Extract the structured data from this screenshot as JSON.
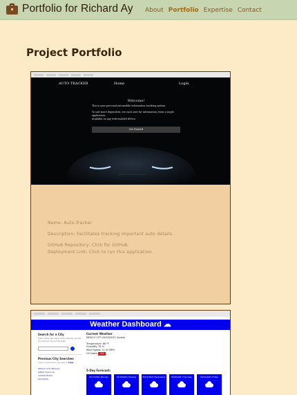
{
  "header": {
    "brand_icon": "briefcase-icon",
    "title": "Portfolio for Richard Ay",
    "nav": [
      {
        "label": "About",
        "active": false
      },
      {
        "label": "Portfolio",
        "active": true
      },
      {
        "label": "Expertise",
        "active": false
      },
      {
        "label": "Contact",
        "active": false
      }
    ]
  },
  "main": {
    "section_title": "Project Portfolio"
  },
  "projects": [
    {
      "screenshot": {
        "nav": {
          "brand": "AUTO TRACKER",
          "home": "Home",
          "login": "Login"
        },
        "welcome_title": "Welcome!",
        "welcome_line1": "This is your personal automobile information tracking system.",
        "welcome_line2": "To sort more dependent, see each user for information, from a single application,",
        "welcome_line3": "available on any web-enabled device.",
        "button": "Get Started"
      },
      "name": "Name: Auto-Tracker",
      "description": "Description: Facilitates tracking important auto details.",
      "github": "GitHub Repository: Click for GitHub.",
      "deployment": "Deployment Link: Click to run this application."
    },
    {
      "screenshot": {
        "title": "Weather Dashboard",
        "search_label": "Search for a City",
        "search_hint": "Enter either the name of the desired city OR the desired city and its state",
        "previous_label": "Previous City Searches",
        "previous_hint": "Click on a previous city search",
        "clear_label": "Clear",
        "cities": [
          "MEXICO CITY,MEXICO",
          "GREAT FALLS,US",
          "AUSTIN,TEXAS",
          "HOUSTON"
        ],
        "current_label": "Current Weather",
        "city_line": "MEXICO CITY 05/05/2021 Sunday",
        "temp": "Temperature: 66 °F",
        "humidity": "Humidity: 39 %",
        "wind": "Wind Speed: 11.97 MPH",
        "uv_label": "UV Index:",
        "uv_value": "3.5",
        "forecast_label": "5-Day Forecast:",
        "forecast": [
          "05/17/2021 Monday",
          "05/18/2021 Tuesday",
          "05/19/2021 Wednesday",
          "05/20/2021 Thursday",
          "05/21/2021 Friday"
        ]
      }
    }
  ],
  "colors": {
    "page_bg": "#fdebc8",
    "topbar_bg": "#c7d6b0",
    "card_bg": "#f2cfa0",
    "card_border": "#6b3a12",
    "nav_active": "#a06a1a",
    "weather_blue": "#0000ee"
  }
}
